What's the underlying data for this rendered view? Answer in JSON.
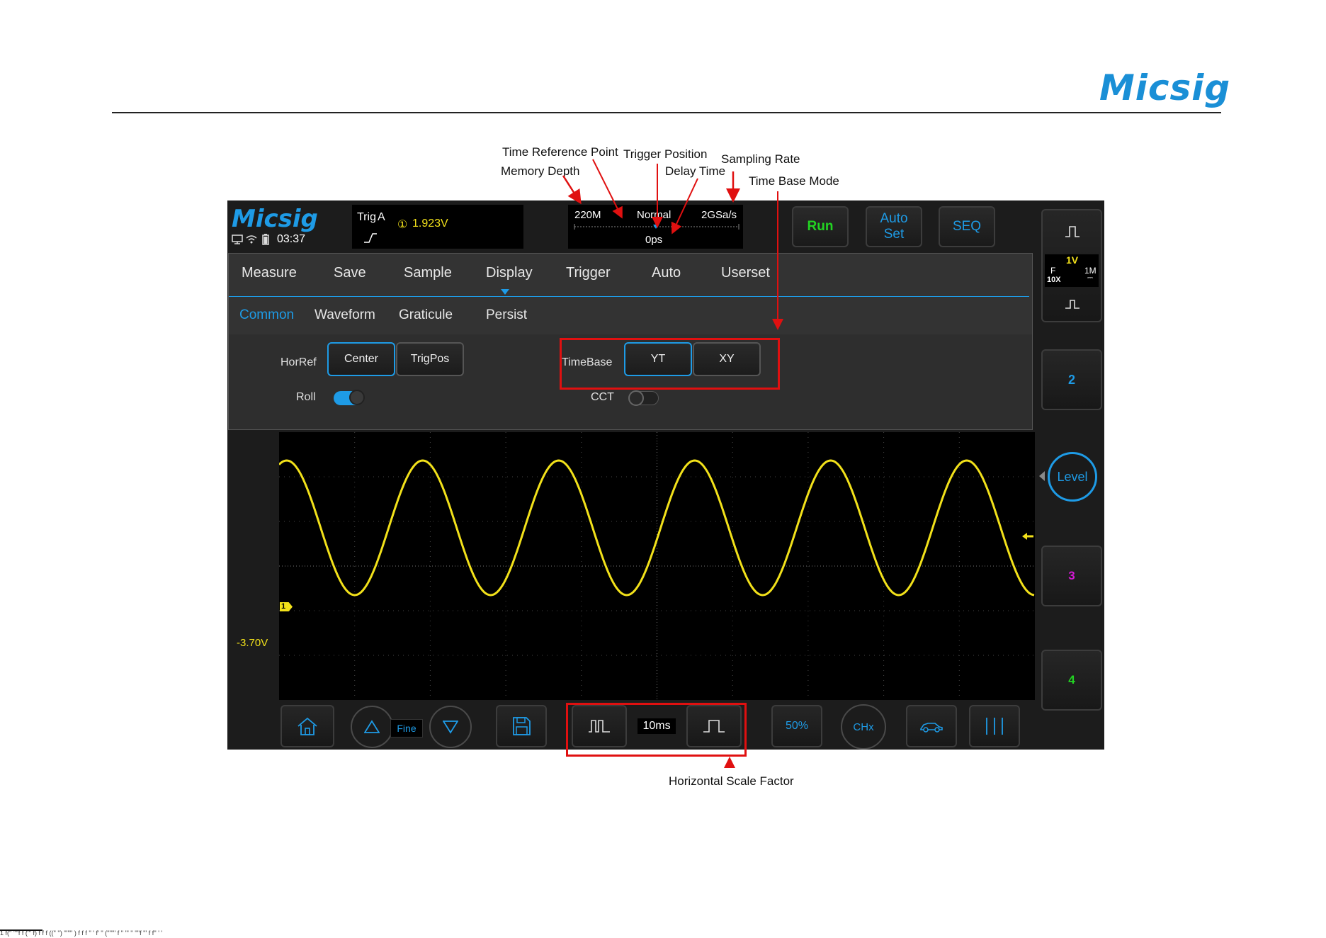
{
  "page": {
    "brand": "Micsig",
    "footer_fragment": "1 f('' ''''f f (''' f) f f f (('' '') ''''''' )  f f f '' ' f' '' ('''''''  f '' ''' ''  ''''f ''' f f''  ' '"
  },
  "annotations": {
    "time_reference_point": "Time Reference Point",
    "memory_depth": "Memory Depth",
    "trigger_position": "Trigger Position",
    "delay_time": "Delay Time",
    "sampling_rate": "Sampling Rate",
    "time_base_mode": "Time Base Mode",
    "horizontal_scale_factor": "Horizontal Scale Factor"
  },
  "scope": {
    "logo": "Micsig",
    "time": "03:37",
    "trigger": {
      "title": "Trig",
      "source": "A",
      "channel_marker": "①",
      "level": "1.923V"
    },
    "acquisition": {
      "memory_depth": "220M",
      "mode": "Normal",
      "sample_rate": "2GSa/s",
      "delay": "0ps"
    },
    "top_buttons": {
      "run": "Run",
      "autoset_line1": "Auto",
      "autoset_line2": "Set",
      "seq": "SEQ"
    },
    "menu_tabs": [
      "Measure",
      "Save",
      "Sample",
      "Display",
      "Trigger",
      "Auto",
      "Userset"
    ],
    "active_menu": "Display",
    "sub_tabs": [
      "Common",
      "Waveform",
      "Graticule",
      "Persist"
    ],
    "active_sub_tab": "Common",
    "options": {
      "horref_label": "HorRef",
      "horref_center": "Center",
      "horref_trigpos": "TrigPos",
      "timebase_label": "TimeBase",
      "timebase_yt": "YT",
      "timebase_xy": "XY",
      "roll_label": "Roll",
      "roll_on": true,
      "cct_label": "CCT",
      "cct_on": false
    },
    "channel1_offset": "-3.70V",
    "channel1_marker": "1",
    "side": {
      "ch1_scale": "1V",
      "ch1_coupling": "F",
      "ch1_probe": "10X",
      "ch1_impedance": "1M",
      "ch2": "2",
      "level": "Level",
      "ch3": "3",
      "ch4": "4"
    },
    "bottom": {
      "fine": "Fine",
      "timebase": "10ms",
      "fifty": "50%",
      "chx": "CHx"
    },
    "colors": {
      "ch1": "#f2e11a",
      "ch2": "#1e9be6",
      "ch3": "#d41ad4",
      "ch4": "#22d422",
      "accent": "#1e9be6"
    }
  }
}
